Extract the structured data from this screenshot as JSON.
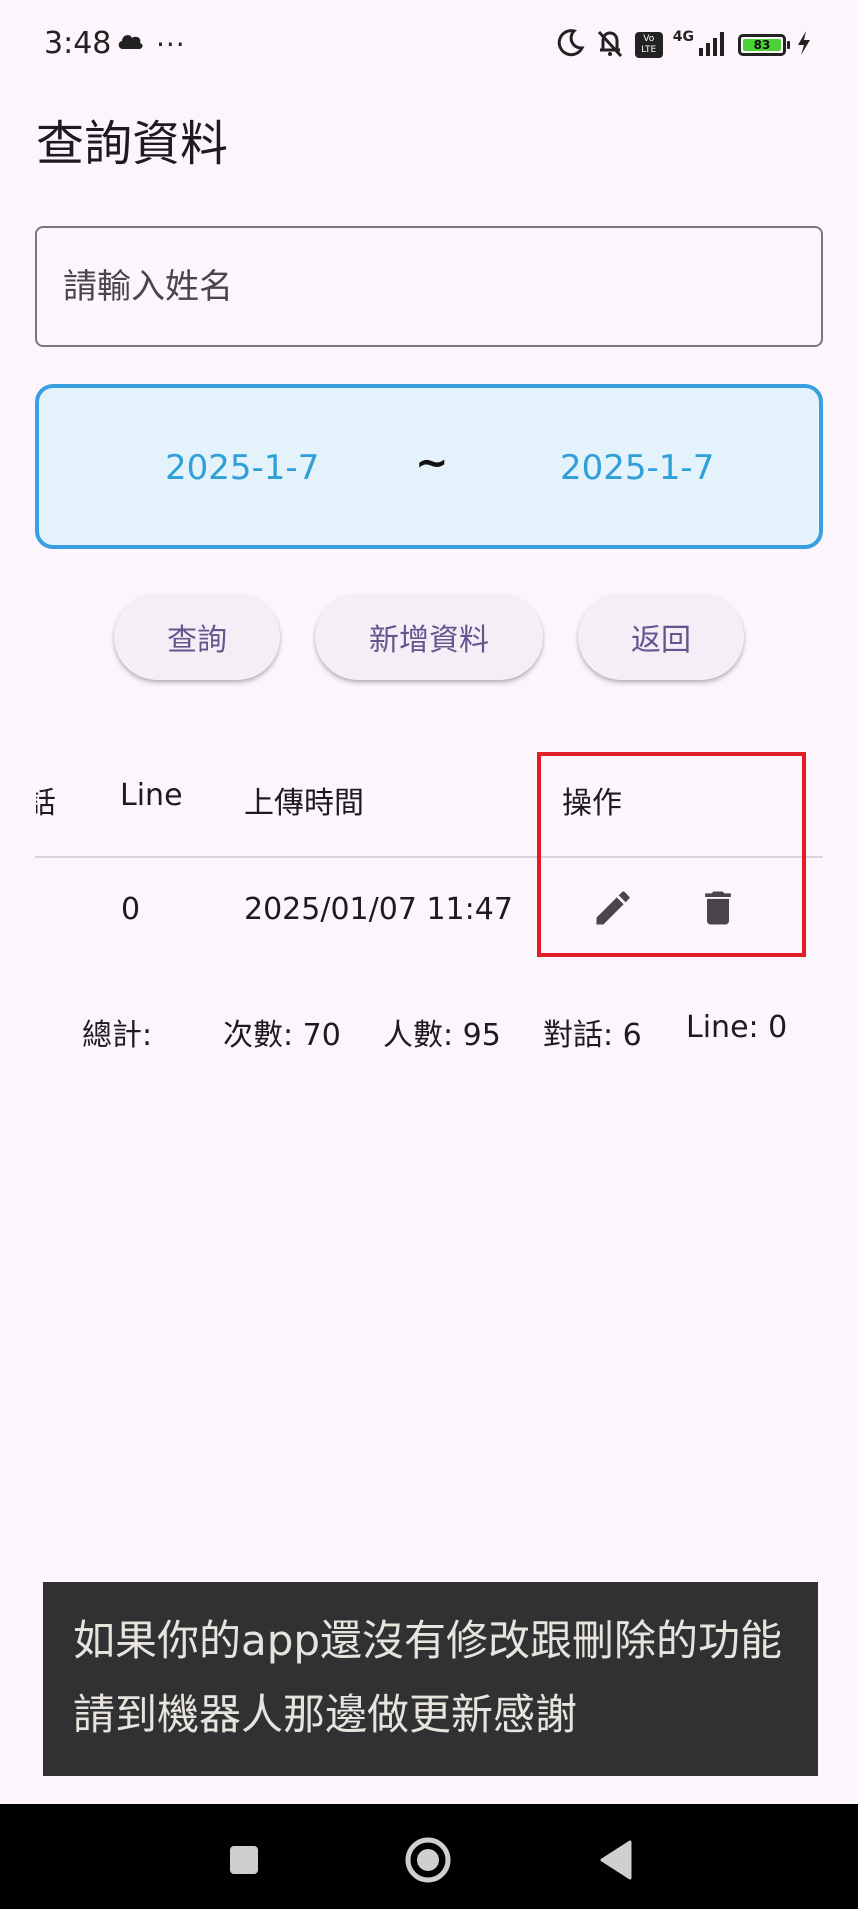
{
  "status_bar": {
    "time": "3:48",
    "more": "···",
    "network": "4G",
    "volte": "Vo\nLTE",
    "battery_level": "83",
    "battery_color": "#4cd237"
  },
  "title": "查詢資料",
  "search": {
    "placeholder": "請輸入姓名",
    "value": ""
  },
  "date_range": {
    "start": "2025-1-7",
    "separator": "~",
    "end": "2025-1-7",
    "accent": "#3a9fe0"
  },
  "buttons": {
    "query": "查詢",
    "add": "新增資料",
    "back": "返回"
  },
  "table": {
    "headers": [
      "話",
      "Line",
      "上傳時間",
      "操作"
    ],
    "rows": [
      {
        "line": "0",
        "upload_time": "2025/01/07 11:47",
        "actions": [
          "edit-icon",
          "delete-icon"
        ]
      }
    ]
  },
  "totals": {
    "label": "總計:",
    "count": "次數: 70",
    "people": "人數: 95",
    "dialog": "對話: 6",
    "line": "Line: 0"
  },
  "snackbar": {
    "line1": "如果你的app還沒有修改跟刪除的功能",
    "line2": "請到機器人那邊做更新感謝"
  },
  "highlight_color": "#e11d2a",
  "nav": [
    "recents-icon",
    "home-icon",
    "back-icon"
  ]
}
